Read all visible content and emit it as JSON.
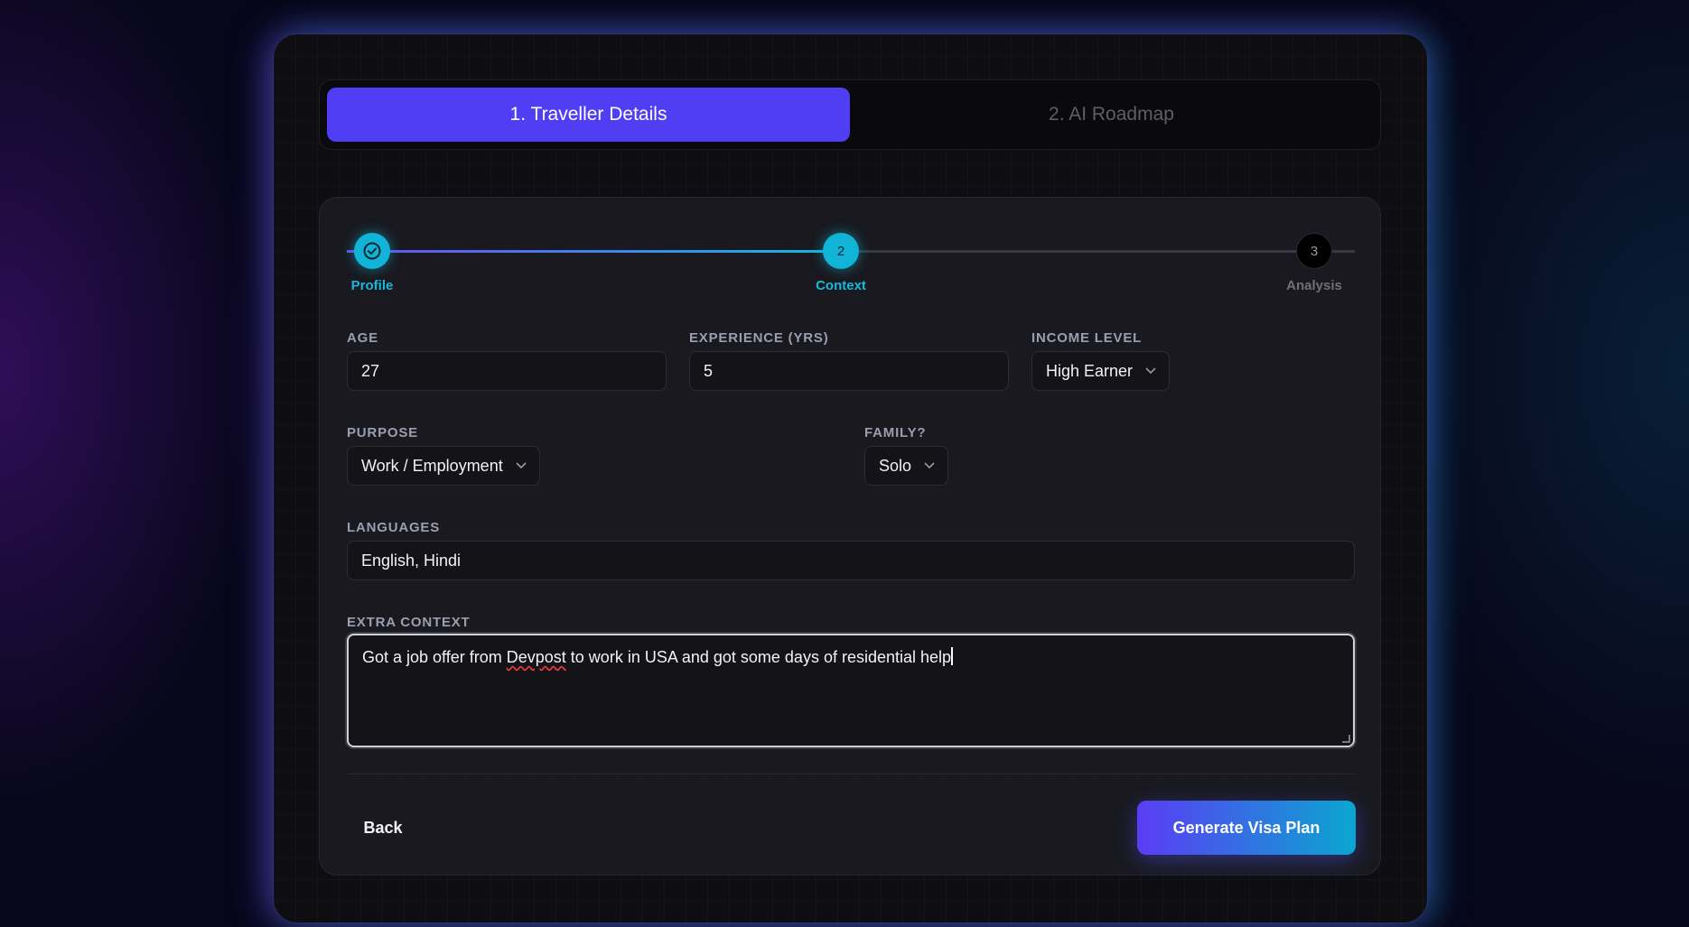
{
  "tabs": [
    {
      "label": "1. Traveller Details",
      "active": true
    },
    {
      "label": "2. AI Roadmap",
      "active": false
    }
  ],
  "stepper": {
    "steps": [
      {
        "label": "Profile",
        "marker": "",
        "state": "done"
      },
      {
        "label": "Context",
        "marker": "2",
        "state": "current"
      },
      {
        "label": "Analysis",
        "marker": "3",
        "state": "pending"
      }
    ],
    "progress_percent": 49
  },
  "form": {
    "age": {
      "label": "AGE",
      "value": "27"
    },
    "experience": {
      "label": "EXPERIENCE (YRS)",
      "value": "5"
    },
    "income": {
      "label": "INCOME LEVEL",
      "value": "High Earner"
    },
    "purpose": {
      "label": "PURPOSE",
      "value": "Work / Employment"
    },
    "family": {
      "label": "FAMILY?",
      "value": "Solo"
    },
    "languages": {
      "label": "LANGUAGES",
      "value": "English, Hindi"
    },
    "extra_context": {
      "label": "EXTRA CONTEXT",
      "value_before": "Got a job offer from ",
      "value_misspelled": "Devpost",
      "value_after": " to work in USA and got some days of residential help"
    }
  },
  "actions": {
    "back_label": "Back",
    "generate_label": "Generate Visa Plan"
  },
  "colors": {
    "accent": "#4f3ef4",
    "cyan": "#11b4d6",
    "background": "#07071a"
  },
  "icons": {
    "completed_step": "check-circle-icon",
    "dropdown": "chevron-down-icon"
  }
}
